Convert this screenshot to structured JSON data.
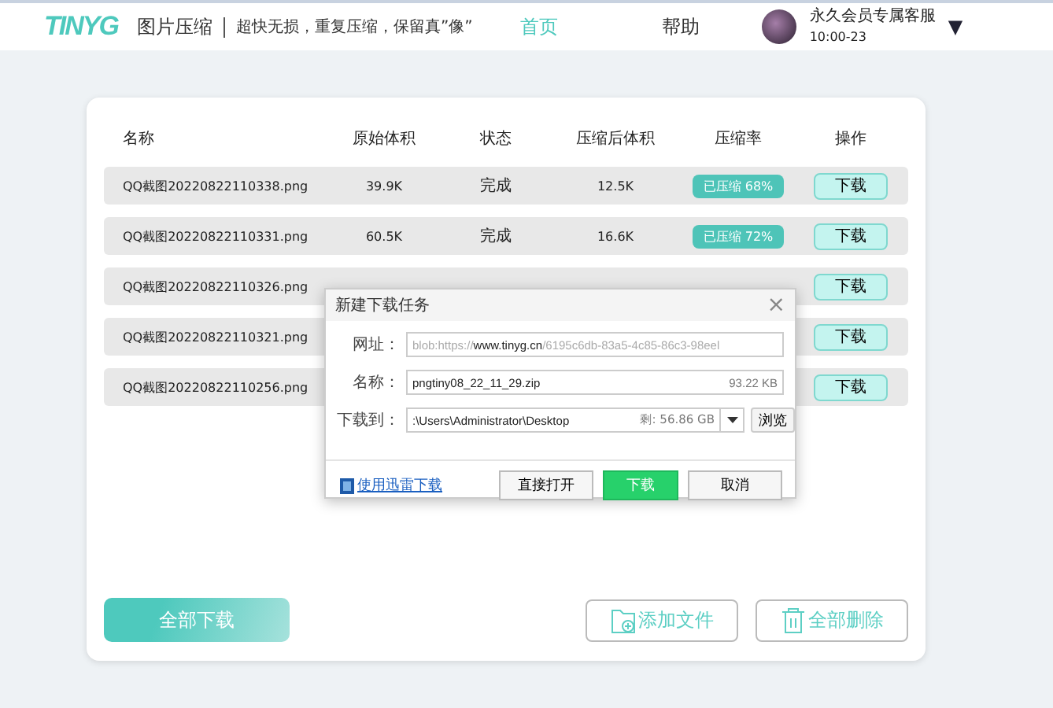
{
  "header": {
    "logo": "TINYG",
    "title": "图片压缩",
    "tagline": "超快无损，重复压缩，保留真”像”",
    "nav": [
      {
        "label": "首页",
        "selected": true
      },
      {
        "label": "帮助",
        "selected": false
      }
    ],
    "service": {
      "name": "永久会员专属客服",
      "hours": "10:00-23",
      "caret": "▼"
    }
  },
  "table": {
    "columns": [
      "名称",
      "原始体积",
      "状态",
      "压缩后体积",
      "压缩率",
      "操作"
    ],
    "rows": [
      {
        "name": "QQ截图20220822110338.png",
        "original": "39.9K",
        "status": "完成",
        "compressed": "12.5K",
        "badge": "已压缩 68%",
        "action": "下载"
      },
      {
        "name": "QQ截图20220822110331.png",
        "original": "60.5K",
        "status": "完成",
        "compressed": "16.6K",
        "badge": "已压缩 72%",
        "action": "下载"
      },
      {
        "name": "QQ截图20220822110326.png",
        "action": "下载"
      },
      {
        "name": "QQ截图20220822110321.png",
        "action": "下载"
      },
      {
        "name": "QQ截图20220822110256.png",
        "action": "下载"
      }
    ]
  },
  "footer": {
    "download_all": "全部下载",
    "add_files": "添加文件",
    "delete_all": "全部删除"
  },
  "dialog": {
    "title": "新建下载任务",
    "close": "×",
    "url": {
      "label": "网址：",
      "prefix": "blob:https://",
      "host": "www.tinyg.cn",
      "suffix": "/6195c6db-83a5-4c85-86c3-98eel"
    },
    "name": {
      "label": "名称：",
      "value": "pngtiny08_22_11_29.zip",
      "size": "93.22 KB"
    },
    "path": {
      "label": "下载到：",
      "value": ":\\Users\\Administrator\\Desktop",
      "free": "剩: 56.86 GB",
      "browse": "浏览"
    },
    "link": "使用迅雷下载",
    "buttons": [
      {
        "label": "直接打开",
        "kind": "default"
      },
      {
        "label": "下载",
        "kind": "primary"
      },
      {
        "label": "取消",
        "kind": "default"
      }
    ]
  }
}
